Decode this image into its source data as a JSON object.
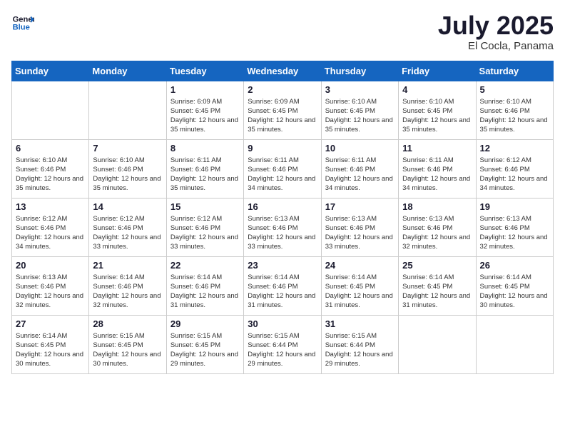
{
  "logo": {
    "line1": "General",
    "line2": "Blue"
  },
  "title": "July 2025",
  "subtitle": "El Cocla, Panama",
  "days_of_week": [
    "Sunday",
    "Monday",
    "Tuesday",
    "Wednesday",
    "Thursday",
    "Friday",
    "Saturday"
  ],
  "weeks": [
    [
      {
        "day": "",
        "sunrise": "",
        "sunset": "",
        "daylight": ""
      },
      {
        "day": "",
        "sunrise": "",
        "sunset": "",
        "daylight": ""
      },
      {
        "day": "1",
        "sunrise": "Sunrise: 6:09 AM",
        "sunset": "Sunset: 6:45 PM",
        "daylight": "Daylight: 12 hours and 35 minutes."
      },
      {
        "day": "2",
        "sunrise": "Sunrise: 6:09 AM",
        "sunset": "Sunset: 6:45 PM",
        "daylight": "Daylight: 12 hours and 35 minutes."
      },
      {
        "day": "3",
        "sunrise": "Sunrise: 6:10 AM",
        "sunset": "Sunset: 6:45 PM",
        "daylight": "Daylight: 12 hours and 35 minutes."
      },
      {
        "day": "4",
        "sunrise": "Sunrise: 6:10 AM",
        "sunset": "Sunset: 6:45 PM",
        "daylight": "Daylight: 12 hours and 35 minutes."
      },
      {
        "day": "5",
        "sunrise": "Sunrise: 6:10 AM",
        "sunset": "Sunset: 6:46 PM",
        "daylight": "Daylight: 12 hours and 35 minutes."
      }
    ],
    [
      {
        "day": "6",
        "sunrise": "Sunrise: 6:10 AM",
        "sunset": "Sunset: 6:46 PM",
        "daylight": "Daylight: 12 hours and 35 minutes."
      },
      {
        "day": "7",
        "sunrise": "Sunrise: 6:10 AM",
        "sunset": "Sunset: 6:46 PM",
        "daylight": "Daylight: 12 hours and 35 minutes."
      },
      {
        "day": "8",
        "sunrise": "Sunrise: 6:11 AM",
        "sunset": "Sunset: 6:46 PM",
        "daylight": "Daylight: 12 hours and 35 minutes."
      },
      {
        "day": "9",
        "sunrise": "Sunrise: 6:11 AM",
        "sunset": "Sunset: 6:46 PM",
        "daylight": "Daylight: 12 hours and 34 minutes."
      },
      {
        "day": "10",
        "sunrise": "Sunrise: 6:11 AM",
        "sunset": "Sunset: 6:46 PM",
        "daylight": "Daylight: 12 hours and 34 minutes."
      },
      {
        "day": "11",
        "sunrise": "Sunrise: 6:11 AM",
        "sunset": "Sunset: 6:46 PM",
        "daylight": "Daylight: 12 hours and 34 minutes."
      },
      {
        "day": "12",
        "sunrise": "Sunrise: 6:12 AM",
        "sunset": "Sunset: 6:46 PM",
        "daylight": "Daylight: 12 hours and 34 minutes."
      }
    ],
    [
      {
        "day": "13",
        "sunrise": "Sunrise: 6:12 AM",
        "sunset": "Sunset: 6:46 PM",
        "daylight": "Daylight: 12 hours and 34 minutes."
      },
      {
        "day": "14",
        "sunrise": "Sunrise: 6:12 AM",
        "sunset": "Sunset: 6:46 PM",
        "daylight": "Daylight: 12 hours and 33 minutes."
      },
      {
        "day": "15",
        "sunrise": "Sunrise: 6:12 AM",
        "sunset": "Sunset: 6:46 PM",
        "daylight": "Daylight: 12 hours and 33 minutes."
      },
      {
        "day": "16",
        "sunrise": "Sunrise: 6:13 AM",
        "sunset": "Sunset: 6:46 PM",
        "daylight": "Daylight: 12 hours and 33 minutes."
      },
      {
        "day": "17",
        "sunrise": "Sunrise: 6:13 AM",
        "sunset": "Sunset: 6:46 PM",
        "daylight": "Daylight: 12 hours and 33 minutes."
      },
      {
        "day": "18",
        "sunrise": "Sunrise: 6:13 AM",
        "sunset": "Sunset: 6:46 PM",
        "daylight": "Daylight: 12 hours and 32 minutes."
      },
      {
        "day": "19",
        "sunrise": "Sunrise: 6:13 AM",
        "sunset": "Sunset: 6:46 PM",
        "daylight": "Daylight: 12 hours and 32 minutes."
      }
    ],
    [
      {
        "day": "20",
        "sunrise": "Sunrise: 6:13 AM",
        "sunset": "Sunset: 6:46 PM",
        "daylight": "Daylight: 12 hours and 32 minutes."
      },
      {
        "day": "21",
        "sunrise": "Sunrise: 6:14 AM",
        "sunset": "Sunset: 6:46 PM",
        "daylight": "Daylight: 12 hours and 32 minutes."
      },
      {
        "day": "22",
        "sunrise": "Sunrise: 6:14 AM",
        "sunset": "Sunset: 6:46 PM",
        "daylight": "Daylight: 12 hours and 31 minutes."
      },
      {
        "day": "23",
        "sunrise": "Sunrise: 6:14 AM",
        "sunset": "Sunset: 6:46 PM",
        "daylight": "Daylight: 12 hours and 31 minutes."
      },
      {
        "day": "24",
        "sunrise": "Sunrise: 6:14 AM",
        "sunset": "Sunset: 6:45 PM",
        "daylight": "Daylight: 12 hours and 31 minutes."
      },
      {
        "day": "25",
        "sunrise": "Sunrise: 6:14 AM",
        "sunset": "Sunset: 6:45 PM",
        "daylight": "Daylight: 12 hours and 31 minutes."
      },
      {
        "day": "26",
        "sunrise": "Sunrise: 6:14 AM",
        "sunset": "Sunset: 6:45 PM",
        "daylight": "Daylight: 12 hours and 30 minutes."
      }
    ],
    [
      {
        "day": "27",
        "sunrise": "Sunrise: 6:14 AM",
        "sunset": "Sunset: 6:45 PM",
        "daylight": "Daylight: 12 hours and 30 minutes."
      },
      {
        "day": "28",
        "sunrise": "Sunrise: 6:15 AM",
        "sunset": "Sunset: 6:45 PM",
        "daylight": "Daylight: 12 hours and 30 minutes."
      },
      {
        "day": "29",
        "sunrise": "Sunrise: 6:15 AM",
        "sunset": "Sunset: 6:45 PM",
        "daylight": "Daylight: 12 hours and 29 minutes."
      },
      {
        "day": "30",
        "sunrise": "Sunrise: 6:15 AM",
        "sunset": "Sunset: 6:44 PM",
        "daylight": "Daylight: 12 hours and 29 minutes."
      },
      {
        "day": "31",
        "sunrise": "Sunrise: 6:15 AM",
        "sunset": "Sunset: 6:44 PM",
        "daylight": "Daylight: 12 hours and 29 minutes."
      },
      {
        "day": "",
        "sunrise": "",
        "sunset": "",
        "daylight": ""
      },
      {
        "day": "",
        "sunrise": "",
        "sunset": "",
        "daylight": ""
      }
    ]
  ]
}
